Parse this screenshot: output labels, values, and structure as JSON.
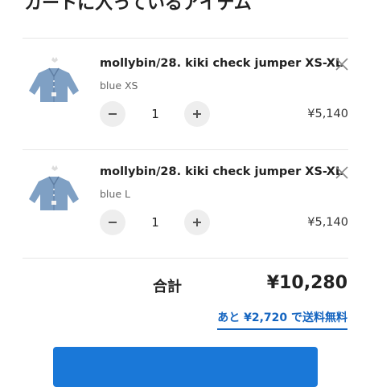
{
  "header": {
    "title": "カートに入っているアイテム"
  },
  "items": [
    {
      "name": "mollybin/28. kiki check jumper XS-XL",
      "variant": "blue XS",
      "quantity": "1",
      "price": "¥5,140",
      "image_icon": "denim-jacket-thumbnail"
    },
    {
      "name": "mollybin/28. kiki check jumper XS-XL",
      "variant": "blue L",
      "quantity": "1",
      "price": "¥5,140",
      "image_icon": "denim-jacket-thumbnail"
    }
  ],
  "summary": {
    "total_label": "合計",
    "total_value": "¥10,280",
    "free_shipping_note": "あと ¥2,720 で送料無料"
  },
  "colors": {
    "accent": "#1565c0",
    "checkout_button": "#1a78d8",
    "stepper_bg": "#eeeeee"
  }
}
